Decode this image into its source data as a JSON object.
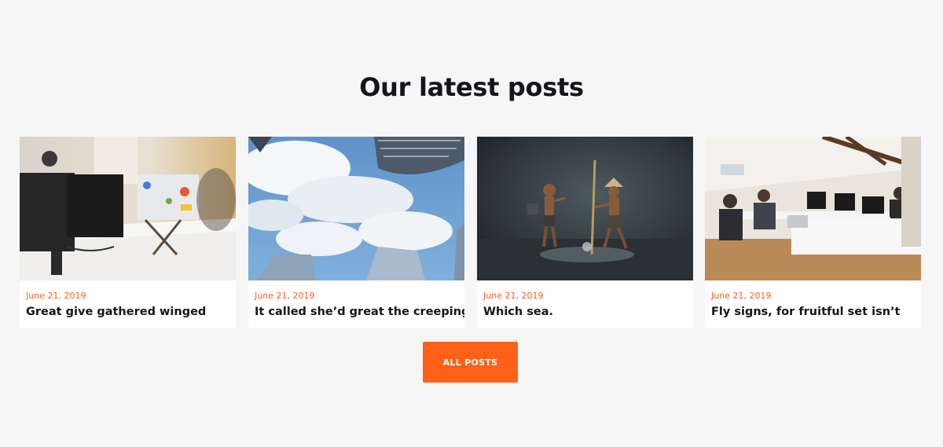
{
  "section": {
    "title": "Our latest posts"
  },
  "posts": [
    {
      "date": "June 21, 2019",
      "title": "Great give gathered winged",
      "image": "office-desk-laptop-photo"
    },
    {
      "date": "June 21, 2019",
      "title": "It called she’d great the creeping.",
      "image": "sky-skyscrapers-photo"
    },
    {
      "date": "June 21, 2019",
      "title": "Which sea.",
      "image": "fishermen-children-photo"
    },
    {
      "date": "June 21, 2019",
      "title": "Fly signs, for fruitful set isn’t",
      "image": "open-office-workers-photo"
    }
  ],
  "all_posts_button": {
    "label": "ALL POSTS"
  },
  "colors": {
    "accent": "#ff6118",
    "date": "#ff5e1a",
    "background": "#f6f6f6",
    "heading": "#14161b"
  }
}
